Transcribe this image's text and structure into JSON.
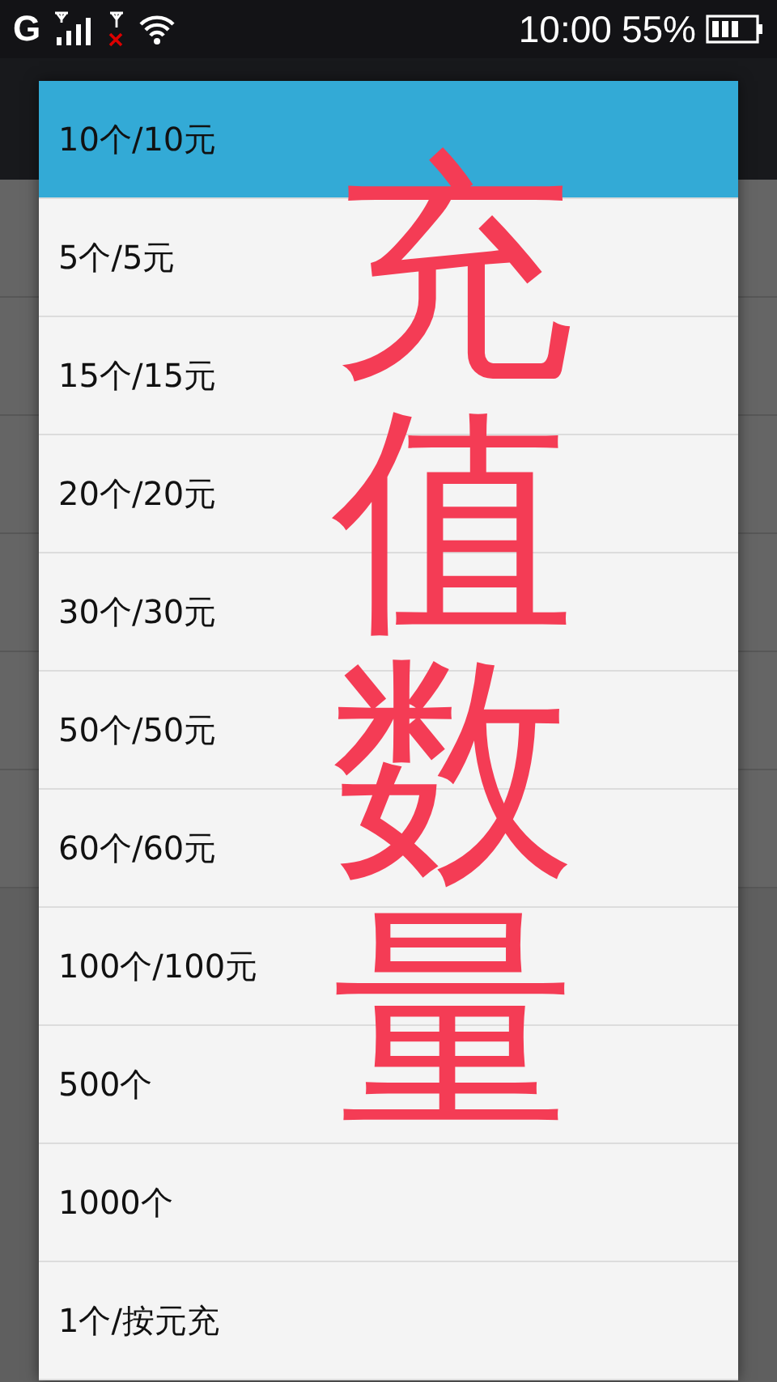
{
  "status_bar": {
    "network": "G",
    "time": "10:00",
    "battery": "55%"
  },
  "dropdown": {
    "options": [
      {
        "label": "10个/10元",
        "selected": true
      },
      {
        "label": "5个/5元",
        "selected": false
      },
      {
        "label": "15个/15元",
        "selected": false
      },
      {
        "label": "20个/20元",
        "selected": false
      },
      {
        "label": "30个/30元",
        "selected": false
      },
      {
        "label": "50个/50元",
        "selected": false
      },
      {
        "label": "60个/60元",
        "selected": false
      },
      {
        "label": "100个/100元",
        "selected": false
      },
      {
        "label": "500个",
        "selected": false
      },
      {
        "label": "1000个",
        "selected": false
      },
      {
        "label": "1个/按元充",
        "selected": false
      }
    ]
  },
  "annotation": {
    "text": "充值数量",
    "color": "#f43c55"
  }
}
